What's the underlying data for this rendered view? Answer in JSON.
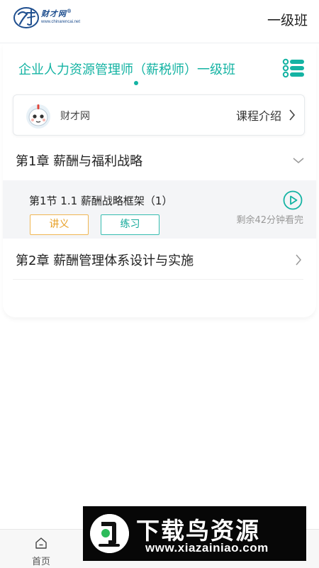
{
  "header": {
    "logo": {
      "brand_cn": "财才网",
      "reg_mark": "®",
      "url": "www.chinarencai.net"
    },
    "level": "一级班"
  },
  "course": {
    "title": "企业人力资源管理师（薪税师）一级班"
  },
  "info_card": {
    "site_name": "财才网",
    "intro_label": "课程介绍"
  },
  "chapters": [
    {
      "title": "第1章 薪酬与福利战略",
      "expanded": true,
      "lessons": [
        {
          "title": "第1节 1.1 薪酬战略框架（1）",
          "notes_label": "讲义",
          "practice_label": "练习",
          "remaining": "剩余42分钟看完"
        }
      ]
    },
    {
      "title": "第2章 薪酬管理体系设计与实施",
      "expanded": false
    }
  ],
  "bottom_nav": {
    "home_label": "首页"
  },
  "watermark": {
    "title": "下载鸟资源",
    "url": "www.xiazainiao.com"
  },
  "colors": {
    "accent": "#14b3a3",
    "notes": "#e79e21",
    "practice": "#14a99a",
    "brand_blue": "#1f4f8f"
  }
}
